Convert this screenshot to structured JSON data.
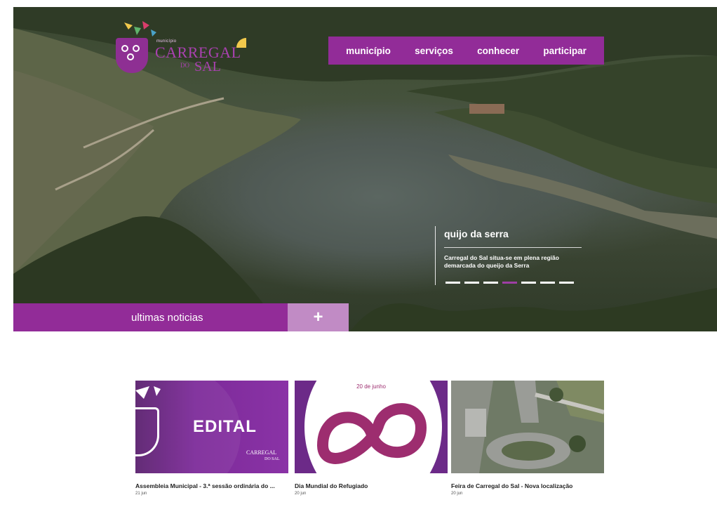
{
  "brand": {
    "small_text": "município",
    "name_line1": "CARREGAL",
    "name_do": "DO",
    "name_line2": "SAL"
  },
  "nav": {
    "items": [
      "município",
      "serviços",
      "conhecer",
      "participar"
    ]
  },
  "slide": {
    "title": "quijo da serra",
    "text": "Carregal do Sal situa-se em plena região demarcada do queijo da Serra",
    "dot_count": 7,
    "active_dot": 4
  },
  "news": {
    "label": "ultimas noticias",
    "more_symbol": "+"
  },
  "cards": [
    {
      "title": "Assembleia Municipal - 3.ª sessão ordinária do ...",
      "date": "21 jun",
      "thumb_text": "EDITAL",
      "thumb_brand": "CARREGAL",
      "thumb_brand_sub": "DO SAL"
    },
    {
      "title": "Dia Mundial do Refugiado",
      "date": "20 jun",
      "thumb_top": "20 de junho"
    },
    {
      "title": "Feira de Carregal do Sal - Nova localização",
      "date": "20 jun"
    }
  ],
  "colors": {
    "brand_purple": "#922c98",
    "light_purple": "#c18bc5",
    "logo_purple": "#a941b0"
  }
}
